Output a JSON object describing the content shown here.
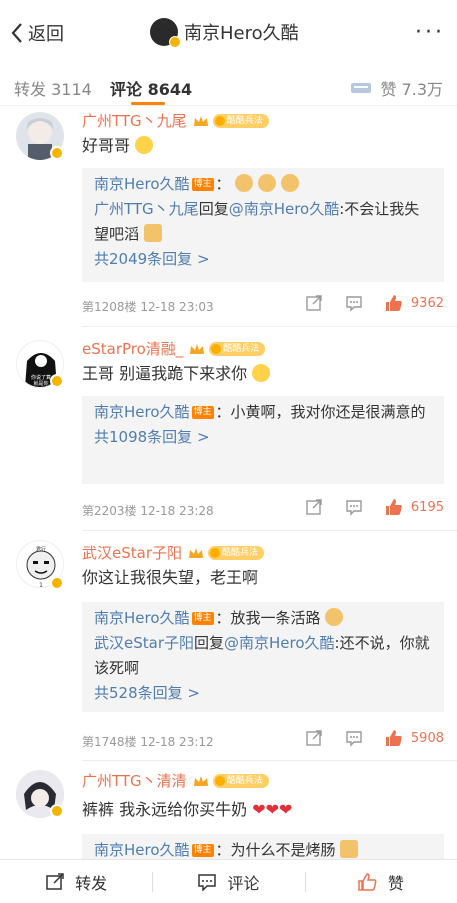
{
  "header": {
    "back_label": "返回",
    "title": "南京Hero久酷"
  },
  "tabs": {
    "forward_label": "转发",
    "forward_count": "3114",
    "comment_label": "评论",
    "comment_count": "8644",
    "like_label": "赞",
    "like_count": "7.3万"
  },
  "comments": [
    {
      "name": "广州TTG丶九尾",
      "text": "好哥哥",
      "fan_badge": "酷酷兵法",
      "replies": {
        "line1_user": "南京Hero久酷",
        "line1_tag": "博主",
        "line1_text": "：",
        "line2_user": "广州TTG丶九尾",
        "line2_mid": "回复",
        "line2_at": "@南京Hero久酷",
        "line2_text": ":不会让我失望吧滔",
        "more": "共2049条回复 >"
      },
      "floor": "第1208楼",
      "time": "12-18 23:03",
      "likes": "9362"
    },
    {
      "name": "eStarPro清融_",
      "text": "王哥 别逼我跪下来求你",
      "fan_badge": "酷酷兵法",
      "avatar_caption_1": "你说了算",
      "avatar_caption_2": "就是你",
      "replies": {
        "line1_user": "南京Hero久酷",
        "line1_tag": "博主",
        "line1_text": "：小黄啊，我对你还是很满意的",
        "more": "共1098条回复 >"
      },
      "floor": "第2203楼",
      "time": "12-18 23:28",
      "likes": "6195"
    },
    {
      "name": "武汉eStar子阳",
      "text": "你这让我很失望，老王啊",
      "fan_badge": "酷酷兵法",
      "avatar_caption_1": "君行",
      "avatar_level": "1",
      "replies": {
        "line1_user": "南京Hero久酷",
        "line1_tag": "博主",
        "line1_text": "：放我一条活路",
        "line2_user": "武汉eStar子阳",
        "line2_mid": "回复",
        "line2_at": "@南京Hero久酷",
        "line2_text": ":还不说，你就该死啊",
        "more": "共528条回复 >"
      },
      "floor": "第1748楼",
      "time": "12-18 23:12",
      "likes": "5908"
    },
    {
      "name": "广州TTG丶清清",
      "text": "裤裤 我永远给你买牛奶",
      "fan_badge": "酷酷兵法",
      "replies": {
        "line1_user": "南京Hero久酷",
        "line1_tag": "博主",
        "line1_text": "：为什么不是烤肠"
      }
    }
  ],
  "bottom": {
    "forward": "转发",
    "comment": "评论",
    "like": "赞"
  },
  "colors": {
    "accent": "#ff8200",
    "username": "#eb7350",
    "link": "#507daf",
    "like_active": "#eb7350"
  }
}
